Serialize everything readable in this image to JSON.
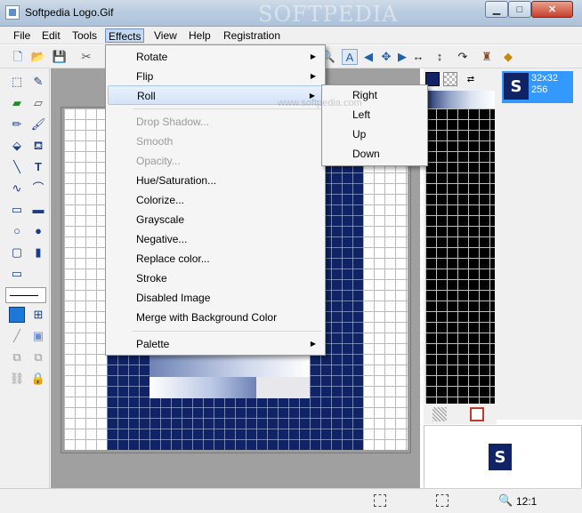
{
  "window": {
    "title": "Softpedia Logo.Gif",
    "watermark": "SOFTPEDIA",
    "watermark_url": "www.softpedia.com"
  },
  "menubar": [
    "File",
    "Edit",
    "Tools",
    "Effects",
    "View",
    "Help",
    "Registration"
  ],
  "effects_menu": {
    "items": [
      {
        "label": "Rotate",
        "submenu": true,
        "enabled": true
      },
      {
        "label": "Flip",
        "submenu": true,
        "enabled": true
      },
      {
        "label": "Roll",
        "submenu": true,
        "enabled": true,
        "highlighted": true
      },
      {
        "label": "Drop Shadow...",
        "enabled": false
      },
      {
        "label": "Smooth",
        "enabled": false
      },
      {
        "label": "Opacity...",
        "enabled": false
      },
      {
        "label": "Hue/Saturation...",
        "enabled": true
      },
      {
        "label": "Colorize...",
        "enabled": true
      },
      {
        "label": "Grayscale",
        "enabled": true
      },
      {
        "label": "Negative...",
        "enabled": true
      },
      {
        "label": "Replace color...",
        "enabled": true
      },
      {
        "label": "Stroke",
        "enabled": true
      },
      {
        "label": "Disabled Image",
        "enabled": true
      },
      {
        "label": "Merge with Background Color",
        "enabled": true
      },
      {
        "label": "Palette",
        "submenu": true,
        "enabled": true
      }
    ]
  },
  "roll_submenu": [
    "Right",
    "Left",
    "Up",
    "Down"
  ],
  "image_info": {
    "size": "32x32",
    "colors": "256"
  },
  "logo_letter": "S",
  "status": {
    "zoom": "12:1"
  },
  "colors": {
    "accent": "#3399ff",
    "logo_bg": "#0f2366",
    "menu_highlight": "#d3e3f7"
  }
}
